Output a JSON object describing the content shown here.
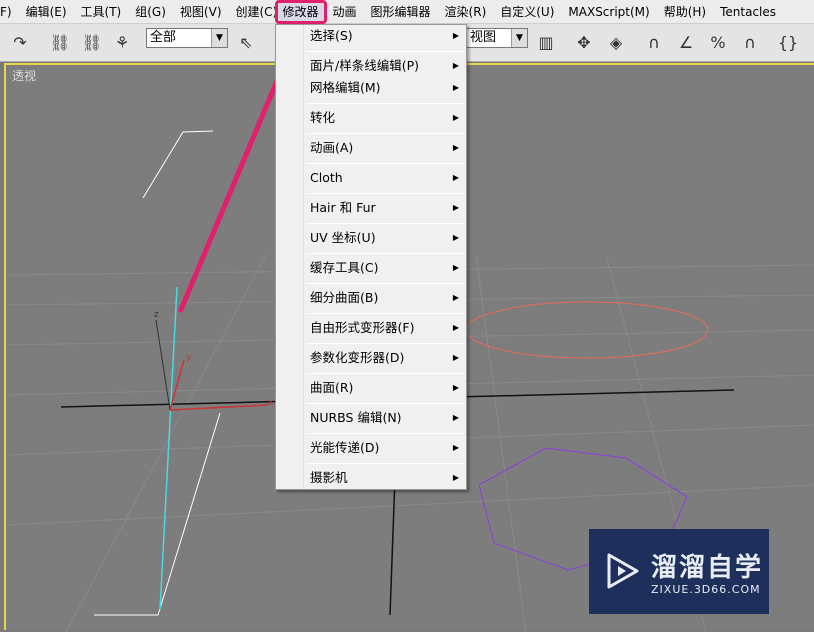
{
  "menubar": [
    "F)",
    "编辑(E)",
    "工具(T)",
    "组(G)",
    "视图(V)",
    "创建(C)",
    "修改器",
    "动画",
    "图形编辑器",
    "渲染(R)",
    "自定义(U)",
    "MAXScript(M)",
    "帮助(H)",
    "Tentacles"
  ],
  "toolbar": {
    "selection_filter": "全部",
    "view_combo": "视图"
  },
  "viewport": {
    "label": "透视"
  },
  "modifiers_menu": {
    "items": [
      "选择(S)",
      "面片/样条线编辑(P)",
      "网格编辑(M)",
      "转化",
      "动画(A)",
      "Cloth",
      "Hair 和 Fur",
      "UV 坐标(U)",
      "缓存工具(C)",
      "细分曲面(B)",
      "自由形式变形器(F)",
      "参数化变形器(D)",
      "曲面(R)",
      "NURBS 编辑(N)",
      "光能传递(D)",
      "摄影机"
    ]
  },
  "watermark": {
    "title": "溜溜自学",
    "url": "ZIXUE.3D66.COM"
  },
  "colors": {
    "highlight": "#e0206a",
    "viewport_border": "#e6d64a",
    "ellipse": "#e86a5a",
    "polygon": "#8a3ee0"
  }
}
